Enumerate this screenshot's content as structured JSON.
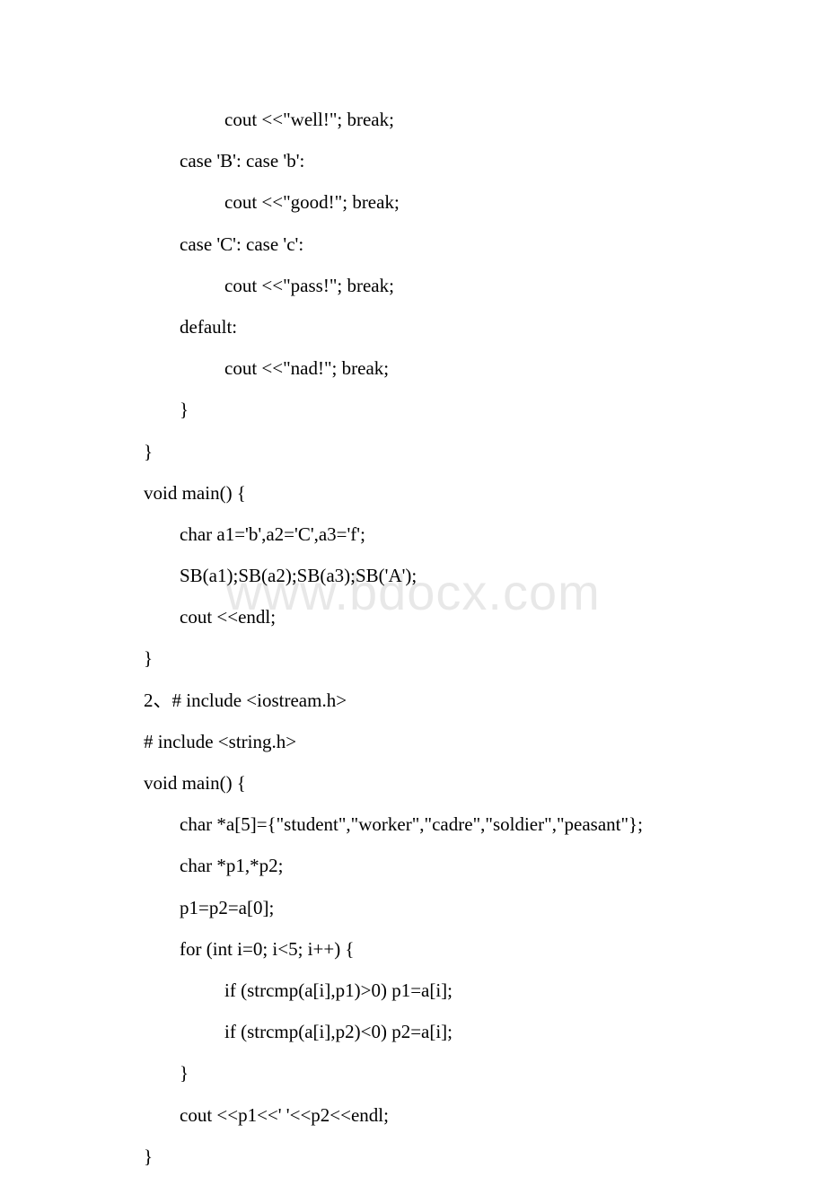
{
  "watermark": "www.bdocx.com",
  "lines": [
    {
      "indent": 2,
      "text": "cout <<\"well!\"; break;"
    },
    {
      "indent": 1,
      "text": "case 'B': case 'b':"
    },
    {
      "indent": 2,
      "text": "cout <<\"good!\"; break;"
    },
    {
      "indent": 1,
      "text": "case 'C': case 'c':"
    },
    {
      "indent": 2,
      "text": "cout <<\"pass!\"; break;"
    },
    {
      "indent": 1,
      "text": "default:"
    },
    {
      "indent": 2,
      "text": "cout <<\"nad!\"; break;"
    },
    {
      "indent": 1,
      "text": "}"
    },
    {
      "indent": 0,
      "text": "}"
    },
    {
      "indent": 0,
      "text": "void main() {"
    },
    {
      "indent": 1,
      "text": "char a1='b',a2='C',a3='f';"
    },
    {
      "indent": 1,
      "text": "SB(a1);SB(a2);SB(a3);SB('A');"
    },
    {
      "indent": 1,
      "text": "cout <<endl;"
    },
    {
      "indent": 0,
      "text": "}"
    },
    {
      "indent": 0,
      "text": "2、# include <iostream.h>"
    },
    {
      "indent": 0,
      "text": "# include <string.h>"
    },
    {
      "indent": 0,
      "text": "void main() {"
    },
    {
      "indent": 1,
      "text": "char *a[5]={\"student\",\"worker\",\"cadre\",\"soldier\",\"peasant\"};"
    },
    {
      "indent": 1,
      "text": "char *p1,*p2;"
    },
    {
      "indent": 1,
      "text": "p1=p2=a[0];"
    },
    {
      "indent": 1,
      "text": "for (int i=0; i<5; i++) {"
    },
    {
      "indent": 2,
      "text": "if (strcmp(a[i],p1)>0) p1=a[i];"
    },
    {
      "indent": 2,
      "text": "if (strcmp(a[i],p2)<0) p2=a[i];"
    },
    {
      "indent": 1,
      "text": "}"
    },
    {
      "indent": 1,
      "text": "cout <<p1<<' '<<p2<<endl;"
    },
    {
      "indent": 0,
      "text": "}"
    }
  ]
}
